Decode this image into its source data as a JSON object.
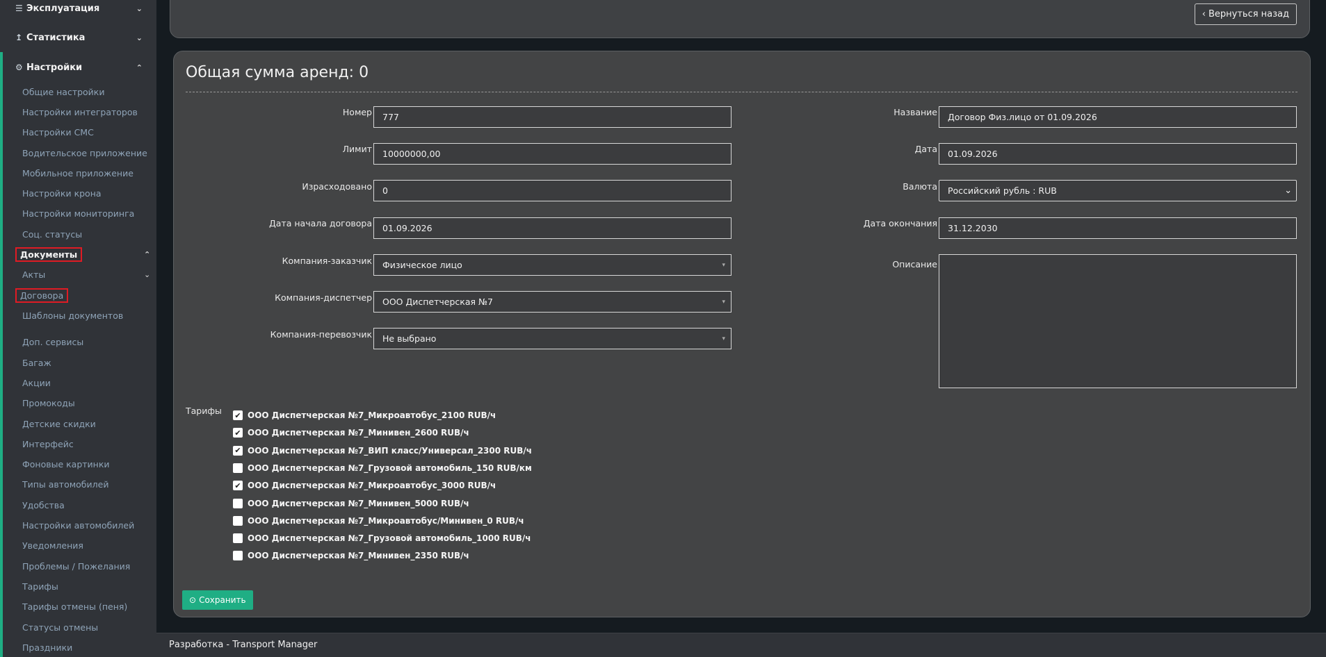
{
  "sidebar": {
    "sections": [
      {
        "label": "Эксплуатация",
        "icon": "list-icon"
      },
      {
        "label": "Статистика",
        "icon": "upload-icon"
      },
      {
        "label": "Настройки",
        "icon": "gear-icon"
      }
    ],
    "items": [
      "Общие настройки",
      "Настройки интеграторов",
      "Настройки СМС",
      "Водительское приложение",
      "Мобильное приложение",
      "Настройки крона",
      "Настройки мониторинга",
      "Соц. статусы",
      "Документы",
      "Акты",
      "Договора",
      "Шаблоны документов",
      "Доп. сервисы",
      "Багаж",
      "Акции",
      "Промокоды",
      "Детские скидки",
      "Интерфейс",
      "Фоновые картинки",
      "Типы автомобилей",
      "Удобства",
      "Настройки автомобилей",
      "Уведомления",
      "Проблемы / Пожелания",
      "Тарифы",
      "Тарифы отмены (пеня)",
      "Статусы отмены",
      "Праздники"
    ]
  },
  "header": {
    "back_label": "Вернуться назад"
  },
  "form": {
    "title": "Общая сумма аренд: 0",
    "labels": {
      "number": "Номер",
      "limit": "Лимит",
      "spent": "Израсходовано",
      "start_date": "Дата начала договора",
      "customer": "Компания-заказчик",
      "dispatcher": "Компания-диспетчер",
      "carrier": "Компания-перевозчик",
      "name": "Название",
      "date": "Дата",
      "currency": "Валюта",
      "end_date": "Дата окончания",
      "description": "Описание",
      "tariffs": "Тарифы"
    },
    "values": {
      "number": "777",
      "limit": "10000000,00",
      "spent": "0",
      "start_date": "01.09.2026",
      "customer": "Физическое лицо",
      "dispatcher": "ООО Диспетчерская №7",
      "carrier": "Не выбрано",
      "name": "Договор Физ.лицо от 01.09.2026",
      "date": "01.09.2026",
      "currency": "Российский рубль : RUB",
      "end_date": "31.12.2030"
    },
    "tariffs": [
      {
        "label": "ООО Диспетчерская №7_Микроавтобус_2100 RUB/ч",
        "checked": true
      },
      {
        "label": "ООО Диспетчерская №7_Минивен_2600 RUB/ч",
        "checked": true
      },
      {
        "label": "ООО Диспетчерская №7_ВИП класс/Универсал_2300 RUB/ч",
        "checked": true
      },
      {
        "label": "ООО Диспетчерская №7_Грузовой автомобиль_150 RUB/км",
        "checked": false
      },
      {
        "label": "ООО Диспетчерская №7_Микроавтобус_3000 RUB/ч",
        "checked": true
      },
      {
        "label": "ООО Диспетчерская №7_Минивен_5000 RUB/ч",
        "checked": false
      },
      {
        "label": "ООО Диспетчерская №7_Микроавтобус/Минивен_0 RUB/ч",
        "checked": false
      },
      {
        "label": "ООО Диспетчерская №7_Грузовой автомобиль_1000 RUB/ч",
        "checked": false
      },
      {
        "label": "ООО Диспетчерская №7_Минивен_2350 RUB/ч",
        "checked": false
      }
    ],
    "save_label": "Сохранить"
  },
  "footer": {
    "text": "Разработка - Transport Manager"
  },
  "colors": {
    "accent": "#1fae84",
    "highlight": "#e01b24"
  }
}
